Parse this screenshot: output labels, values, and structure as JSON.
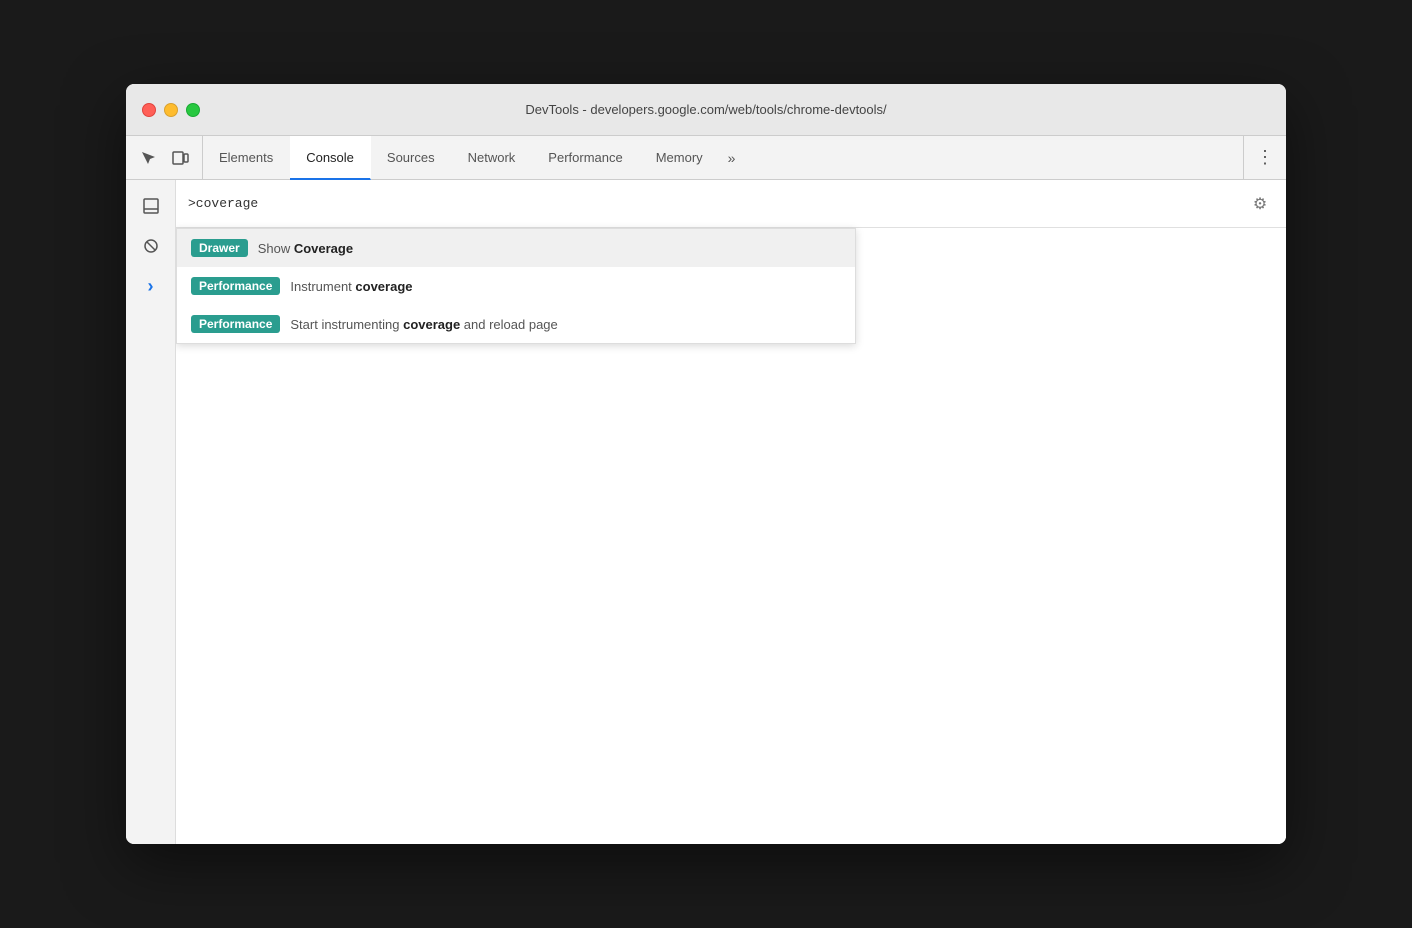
{
  "window": {
    "title": "DevTools - developers.google.com/web/tools/chrome-devtools/",
    "traffic_lights": {
      "close": "close",
      "minimize": "minimize",
      "maximize": "maximize"
    }
  },
  "tabs": {
    "items": [
      {
        "label": "Elements",
        "active": false
      },
      {
        "label": "Console",
        "active": true
      },
      {
        "label": "Sources",
        "active": false
      },
      {
        "label": "Network",
        "active": false
      },
      {
        "label": "Performance",
        "active": false
      },
      {
        "label": "Memory",
        "active": false
      }
    ],
    "overflow_label": "»",
    "more_label": "⋮"
  },
  "console": {
    "input_value": ">coverage",
    "gear_icon": "⚙"
  },
  "autocomplete": {
    "items": [
      {
        "badge_label": "Drawer",
        "badge_class": "badge-drawer",
        "text_prefix": "Show ",
        "text_highlight": "Coverage",
        "text_suffix": ""
      },
      {
        "badge_label": "Performance",
        "badge_class": "badge-performance",
        "text_prefix": "Instrument ",
        "text_highlight": "coverage",
        "text_suffix": ""
      },
      {
        "badge_label": "Performance",
        "badge_class": "badge-performance",
        "text_prefix": "Start instrumenting ",
        "text_highlight": "coverage",
        "text_suffix": " and reload page"
      }
    ]
  },
  "sidebar": {
    "chevron": "›"
  }
}
